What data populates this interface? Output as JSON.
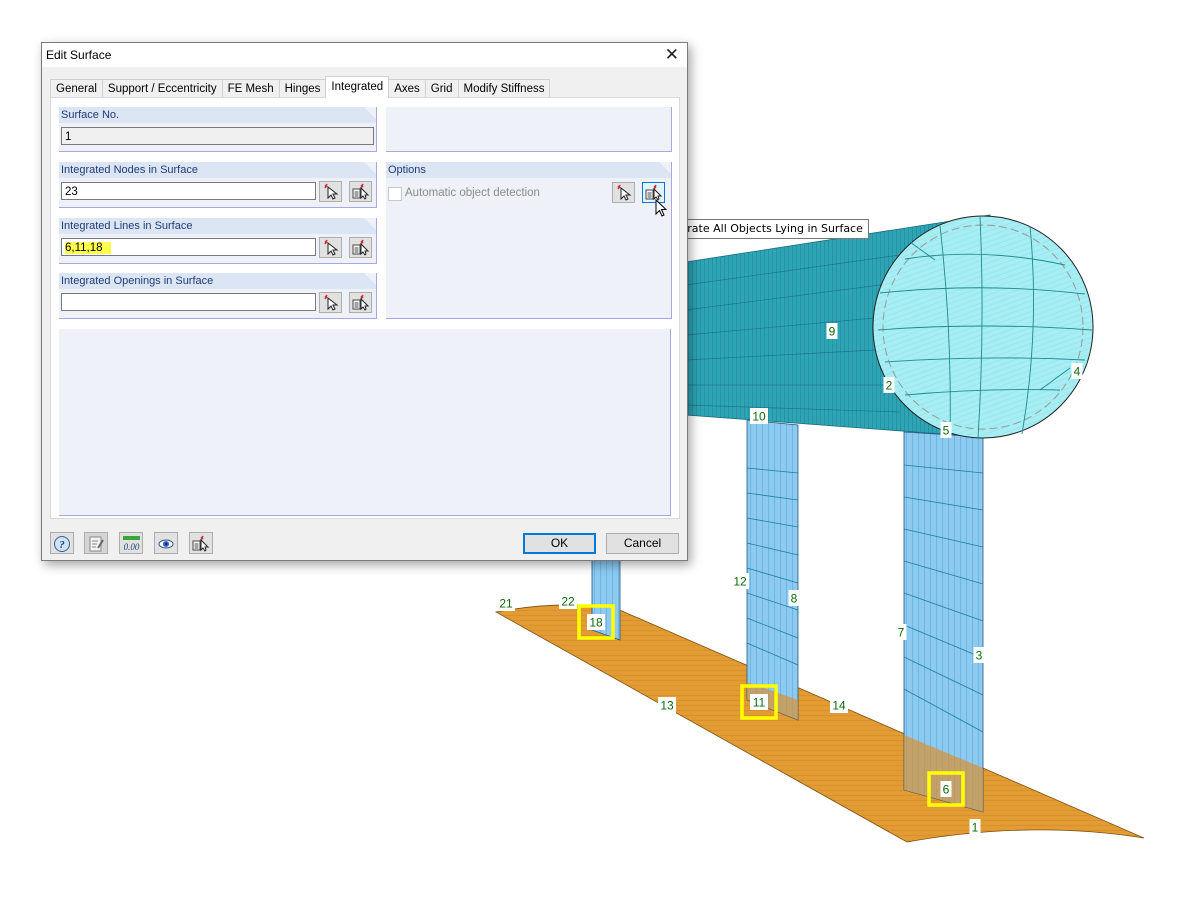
{
  "dialog": {
    "title": "Edit Surface",
    "close_label": "✕",
    "tabs": [
      {
        "label": "General",
        "active": false
      },
      {
        "label": "Support / Eccentricity",
        "active": false
      },
      {
        "label": "FE Mesh",
        "active": false
      },
      {
        "label": "Hinges",
        "active": false
      },
      {
        "label": "Integrated",
        "active": true
      },
      {
        "label": "Axes",
        "active": false
      },
      {
        "label": "Grid",
        "active": false
      },
      {
        "label": "Modify Stiffness",
        "active": false
      }
    ],
    "surface_no": {
      "label": "Surface No.",
      "value": "1"
    },
    "integrated_nodes": {
      "label": "Integrated Nodes in Surface",
      "value": "23"
    },
    "integrated_lines": {
      "label": "Integrated Lines in Surface",
      "value": "6,11,18"
    },
    "integrated_openings": {
      "label": "Integrated Openings in Surface",
      "value": ""
    },
    "options": {
      "label": "Options",
      "auto_detect_label": "Automatic object detection",
      "auto_detect_checked": false,
      "auto_detect_enabled": false
    },
    "tooltip": "Integrate All Objects Lying in Surface",
    "footer_icons": [
      "help-icon",
      "edit-notes-icon",
      "units-decimal-icon",
      "view-eye-icon",
      "pick-list-icon"
    ],
    "units_icon_text": "0.00",
    "ok_label": "OK",
    "cancel_label": "Cancel"
  },
  "model": {
    "highlight_color": "#ffff00",
    "label_color": "#0b6b0b",
    "colors": {
      "cylinder": "#2aa0b0",
      "cylinder_end": "#a6eef4",
      "wall": "#8ccaf2",
      "slab": "#e09a30"
    },
    "line_labels": [
      {
        "text": "9",
        "highlighted": false
      },
      {
        "text": "2",
        "highlighted": false
      },
      {
        "text": "4",
        "highlighted": false
      },
      {
        "text": "5",
        "highlighted": false
      },
      {
        "text": "10",
        "highlighted": false
      },
      {
        "text": "12",
        "highlighted": false
      },
      {
        "text": "8",
        "highlighted": false
      },
      {
        "text": "7",
        "highlighted": false
      },
      {
        "text": "3",
        "highlighted": false
      },
      {
        "text": "21",
        "highlighted": false
      },
      {
        "text": "22",
        "highlighted": false
      },
      {
        "text": "18",
        "highlighted": true
      },
      {
        "text": "13",
        "highlighted": false
      },
      {
        "text": "11",
        "highlighted": true
      },
      {
        "text": "14",
        "highlighted": false
      },
      {
        "text": "6",
        "highlighted": true
      },
      {
        "text": "1",
        "highlighted": false
      }
    ]
  }
}
